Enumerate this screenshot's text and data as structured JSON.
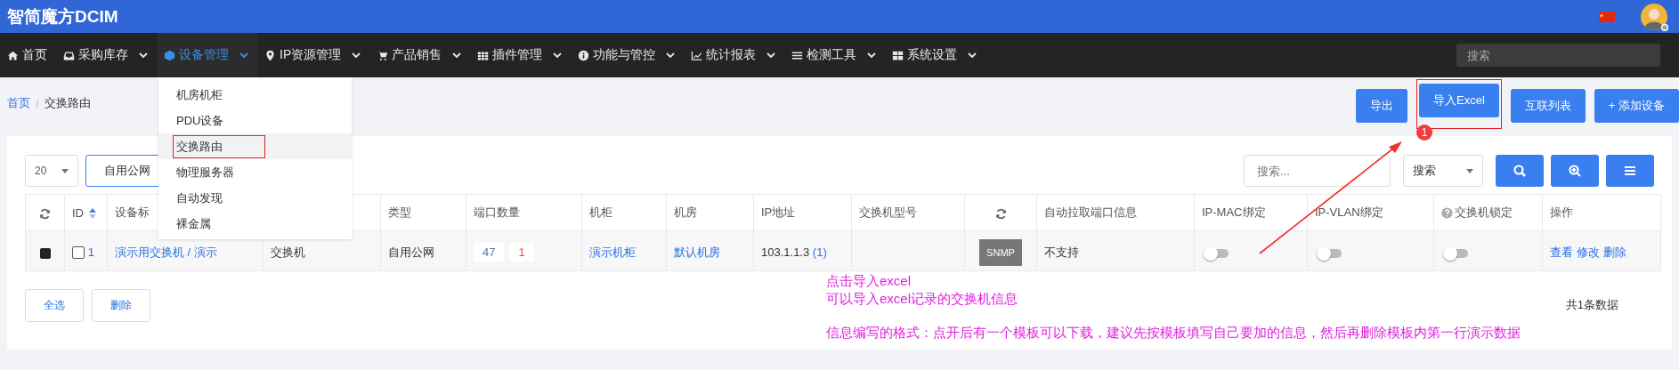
{
  "app": {
    "title": "智简魔方DCIM"
  },
  "nav": {
    "items": [
      {
        "label": "首页",
        "selected": false,
        "dropdown": false
      },
      {
        "label": "采购库存",
        "selected": false,
        "dropdown": true
      },
      {
        "label": "设备管理",
        "selected": true,
        "dropdown": true
      },
      {
        "label": "IP资源管理",
        "selected": false,
        "dropdown": true
      },
      {
        "label": "产品销售",
        "selected": false,
        "dropdown": true
      },
      {
        "label": "插件管理",
        "selected": false,
        "dropdown": true
      },
      {
        "label": "功能与管控",
        "selected": false,
        "dropdown": true
      },
      {
        "label": "统计报表",
        "selected": false,
        "dropdown": true
      },
      {
        "label": "检测工具",
        "selected": false,
        "dropdown": true
      },
      {
        "label": "系统设置",
        "selected": false,
        "dropdown": true
      }
    ],
    "search": {
      "placeholder": "搜索"
    }
  },
  "menu": {
    "items": [
      {
        "label": "机房机柜",
        "highlighted": false
      },
      {
        "label": "PDU设备",
        "highlighted": false
      },
      {
        "label": "交换路由",
        "highlighted": true
      },
      {
        "label": "物理服务器",
        "highlighted": false
      },
      {
        "label": "自动发现",
        "highlighted": false
      },
      {
        "label": "裸金属",
        "highlighted": false
      }
    ]
  },
  "breadcrumb": {
    "separator": "/",
    "items": [
      {
        "label": "首页",
        "link": true
      },
      {
        "label": "交换路由",
        "link": false
      }
    ]
  },
  "actions": [
    {
      "label": "导出",
      "highlighted": false
    },
    {
      "label": "导入Excel",
      "highlighted": true
    },
    {
      "label": "互联列表",
      "highlighted": false
    },
    {
      "label": "+ 添加设备",
      "highlighted": false
    }
  ],
  "toolbar": {
    "page_size": "20",
    "filter": "自用公网",
    "search": {
      "placeholder": "搜索..."
    },
    "search_field": "搜索"
  },
  "table": {
    "columns": [
      {
        "kind": "refresh"
      },
      {
        "kind": "sort",
        "label": "ID"
      },
      {
        "kind": "text",
        "label": "设备标"
      },
      {
        "kind": "blank"
      },
      {
        "kind": "text",
        "label": "类型"
      },
      {
        "kind": "text",
        "label": "端口数量"
      },
      {
        "kind": "text",
        "label": "机柜"
      },
      {
        "kind": "text",
        "label": "机房"
      },
      {
        "kind": "text",
        "label": "IP地址"
      },
      {
        "kind": "text",
        "label": "交换机型号"
      },
      {
        "kind": "refresh"
      },
      {
        "kind": "text",
        "label": "自动拉取端口信息"
      },
      {
        "kind": "text",
        "label": "IP-MAC绑定"
      },
      {
        "kind": "text",
        "label": "IP-VLAN绑定"
      },
      {
        "kind": "help",
        "label": "交换机锁定"
      },
      {
        "kind": "text",
        "label": "操作"
      }
    ],
    "rows": [
      {
        "cells": [
          {
            "kind": "status"
          },
          {
            "kind": "select",
            "checked": false,
            "text": "1"
          },
          {
            "kind": "link",
            "text": "演示用交换机 / 演示"
          },
          {
            "kind": "text",
            "text": "交换机"
          },
          {
            "kind": "text",
            "text": "自用公网"
          },
          {
            "kind": "ports",
            "used": "47",
            "down": "1"
          },
          {
            "kind": "link",
            "text": "演示机柜"
          },
          {
            "kind": "link",
            "text": "默认机房"
          },
          {
            "kind": "ip",
            "text": "103.1.1.3",
            "extra": "(1)"
          },
          {
            "kind": "empty"
          },
          {
            "kind": "tag",
            "text": "SNMP"
          },
          {
            "kind": "text",
            "text": "不支持"
          },
          {
            "kind": "toggle",
            "on": false
          },
          {
            "kind": "toggle",
            "on": false
          },
          {
            "kind": "toggle",
            "on": false
          },
          {
            "kind": "actions",
            "links": [
              "查看",
              "修改",
              "删除"
            ]
          }
        ]
      }
    ]
  },
  "footer": {
    "buttons": [
      "全选",
      "删除"
    ],
    "total": "共1条数据"
  },
  "annotation": {
    "badge": "1",
    "lines": [
      "点击导入excel",
      "可以导入excel记录的交换机信息",
      "信息编写的格式：点开后有一个模板可以下载，建议先按模板填写自己要加的信息，然后再删除模板内第一行演示数据"
    ]
  }
}
